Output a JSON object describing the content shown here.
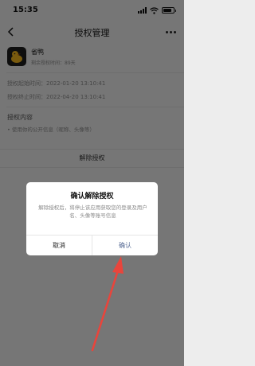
{
  "status_bar": {
    "time": "15:35",
    "battery_level": 0.85
  },
  "nav": {
    "title": "授权管理"
  },
  "app": {
    "name": "省鸭",
    "remaining": "剩余授权时间：89天"
  },
  "authorization": {
    "start": "授权起始时间：2022-01-20 13:10:41",
    "end": "授权终止时间：2022-04-20 13:10:41",
    "content_title": "授权内容",
    "items": [
      "• 使用你的公开信息（昵称、头像等）"
    ]
  },
  "revoke": {
    "label": "解除授权"
  },
  "dialog": {
    "title": "确认解除授权",
    "message": "解除授权后，将停止该应用获取您的登录及用户名、头像等账号信息",
    "cancel_label": "取消",
    "confirm_label": "确认"
  },
  "colors": {
    "confirm_text": "#576b95",
    "annotation_arrow": "#e8453c",
    "app_logo_accent": "#f2b41d"
  },
  "icons": [
    "back-icon",
    "more-icon",
    "signal-icon",
    "wifi-icon",
    "battery-icon",
    "duck-logo"
  ]
}
